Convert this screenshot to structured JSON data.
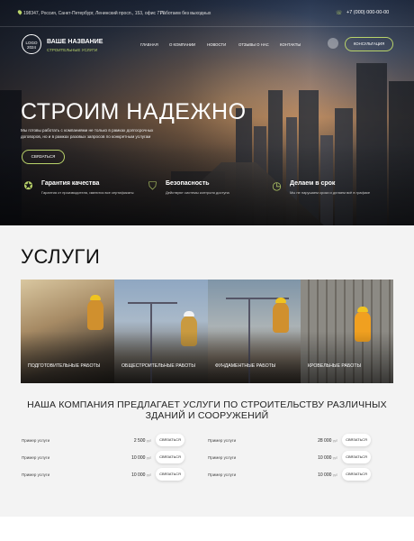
{
  "topbar": {
    "address": "198347, Россия, Санкт-Петербург, Ленинский просп., 153, офис 777",
    "hours": "Работаем без выходных",
    "phone": "+7 (000) 000-00-00"
  },
  "header": {
    "logo": "LOGO",
    "logo_sub": "2024",
    "brand_name": "ВАШЕ НАЗВАНИЕ",
    "brand_tagline": "СТРОИТЕЛЬНЫЕ УСЛУГИ",
    "nav": [
      "ГЛАВНАЯ",
      "О КОМПАНИИ",
      "НОВОСТИ",
      "ОТЗЫВЫ О НАС",
      "КОНТАКТЫ"
    ],
    "consult_label": "КОНСУЛЬТАЦИЯ"
  },
  "hero": {
    "title": "СТРОИМ НАДЕЖНО",
    "lead": "Мы готовы работать с компаниями не только в рамках долгосрочных договоров, но и в рамках разовых запросов по конкретным услугам",
    "cta": "СВЯЗАТЬСЯ",
    "features": [
      {
        "icon": "award-icon",
        "title": "Гарантия качества",
        "desc": "Гарантия от производителя, имеются все сертификаты"
      },
      {
        "icon": "shield-check-icon",
        "title": "Безопасность",
        "desc": "Действуют системы контроля доступа"
      },
      {
        "icon": "clock-icon",
        "title": "Делаем в срок",
        "desc": "Мы не нарушаем сроки и делаем всё в графике"
      }
    ]
  },
  "services": {
    "title": "УСЛУГИ",
    "cards": [
      "ПОДГОТОВИТЕЛЬНЫЕ РАБОТЫ",
      "ОБЩЕСТРОИТЕЛЬНЫЕ РАБОТЫ",
      "ФУНДАМЕНТНЫЕ РАБОТЫ",
      "КРОВЕЛЬНЫЕ РАБОТЫ"
    ]
  },
  "pricing": {
    "title": "НАША КОМПАНИЯ ПРЕДЛАГАЕТ УСЛУГИ ПО СТРОИТЕЛЬСТВУ РАЗЛИЧНЫХ ЗДАНИЙ И СООРУЖЕНИЙ",
    "unit": "руб",
    "button": "СВЯЗАТЬСЯ",
    "left": [
      {
        "name": "Пример услуги",
        "price": "2 500"
      },
      {
        "name": "Пример услуги",
        "price": "10 000"
      },
      {
        "name": "Пример услуги",
        "price": "10 000"
      }
    ],
    "right": [
      {
        "name": "Пример услуги",
        "price": "28 000"
      },
      {
        "name": "Пример услуги",
        "price": "10 000"
      },
      {
        "name": "Пример услуги",
        "price": "10 000"
      }
    ]
  },
  "colors": {
    "accent": "#b9d36a",
    "dark": "#2a2d33"
  }
}
